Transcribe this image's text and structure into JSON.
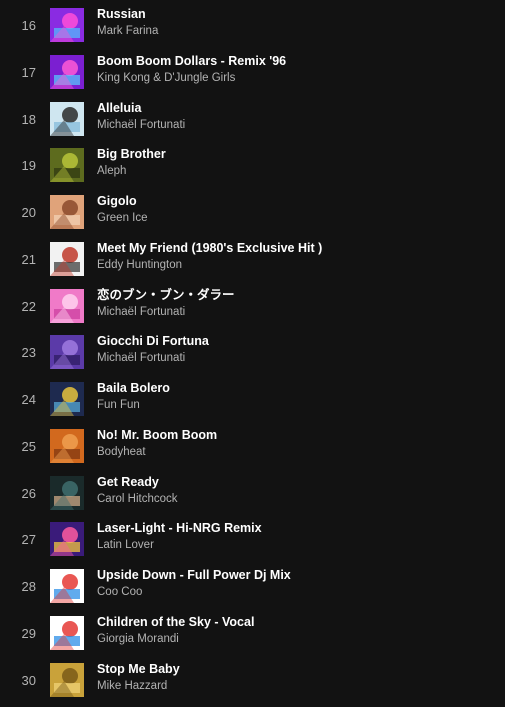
{
  "tracks": [
    {
      "number": "16",
      "title": "Russian",
      "artist": "Mark Farina",
      "art": {
        "bg": "#8a2be2",
        "fg": "#ff4fd8",
        "accent": "#4fc3ff"
      }
    },
    {
      "number": "17",
      "title": "Boom Boom Dollars - Remix '96",
      "artist": "King Kong & D'Jungle Girls",
      "art": {
        "bg": "#7b1fd1",
        "fg": "#ff5ad6",
        "accent": "#55d0ff"
      }
    },
    {
      "number": "18",
      "title": "Alleluia",
      "artist": "Michaël Fortunati",
      "art": {
        "bg": "#cfe6f0",
        "fg": "#2a2a2a",
        "accent": "#7fb8d8"
      }
    },
    {
      "number": "19",
      "title": "Big Brother",
      "artist": "Aleph",
      "art": {
        "bg": "#5d6b1e",
        "fg": "#b8c43a",
        "accent": "#2e3510"
      }
    },
    {
      "number": "20",
      "title": "Gigolo",
      "artist": "Green Ice",
      "art": {
        "bg": "#e0a37a",
        "fg": "#8b4a2b",
        "accent": "#f3d3b8"
      }
    },
    {
      "number": "21",
      "title": "Meet My Friend (1980's Exclusive Hit )",
      "artist": "Eddy Huntington",
      "art": {
        "bg": "#f2f2f2",
        "fg": "#c0392b",
        "accent": "#333333"
      }
    },
    {
      "number": "22",
      "title": "恋のブン・ブン・ダラー",
      "artist": "Michaël Fortunati",
      "art": {
        "bg": "#f07ac8",
        "fg": "#ffd1ef",
        "accent": "#c93c9c"
      }
    },
    {
      "number": "23",
      "title": "Giocchi Di Fortuna",
      "artist": "Michaël Fortunati",
      "art": {
        "bg": "#5b3aa8",
        "fg": "#a07be0",
        "accent": "#2b1a5e"
      }
    },
    {
      "number": "24",
      "title": "Baila Bolero",
      "artist": "Fun Fun",
      "art": {
        "bg": "#1e2a4f",
        "fg": "#e8c33c",
        "accent": "#58b0e0"
      }
    },
    {
      "number": "25",
      "title": "No! Mr. Boom Boom",
      "artist": "Bodyheat",
      "art": {
        "bg": "#d2691e",
        "fg": "#f0a050",
        "accent": "#7a3410"
      }
    },
    {
      "number": "26",
      "title": "Get Ready",
      "artist": "Carol Hitchcock",
      "art": {
        "bg": "#1a2a2a",
        "fg": "#3f6f6f",
        "accent": "#d9b08c"
      }
    },
    {
      "number": "27",
      "title": "Laser-Light - Hi-NRG Remix",
      "artist": "Latin Lover",
      "art": {
        "bg": "#3a1b7a",
        "fg": "#ff5aa0",
        "accent": "#ffd23a"
      }
    },
    {
      "number": "28",
      "title": "Upside Down - Full Power Dj Mix",
      "artist": "Coo Coo",
      "art": {
        "bg": "#ffffff",
        "fg": "#e53935",
        "accent": "#1e88e5"
      }
    },
    {
      "number": "29",
      "title": "Children of the Sky - Vocal",
      "artist": "Giorgia Morandi",
      "art": {
        "bg": "#ffffff",
        "fg": "#e53935",
        "accent": "#1e88e5"
      }
    },
    {
      "number": "30",
      "title": "Stop Me Baby",
      "artist": "Mike Hazzard",
      "art": {
        "bg": "#c9a23a",
        "fg": "#7a5a18",
        "accent": "#f2d67a"
      }
    }
  ]
}
